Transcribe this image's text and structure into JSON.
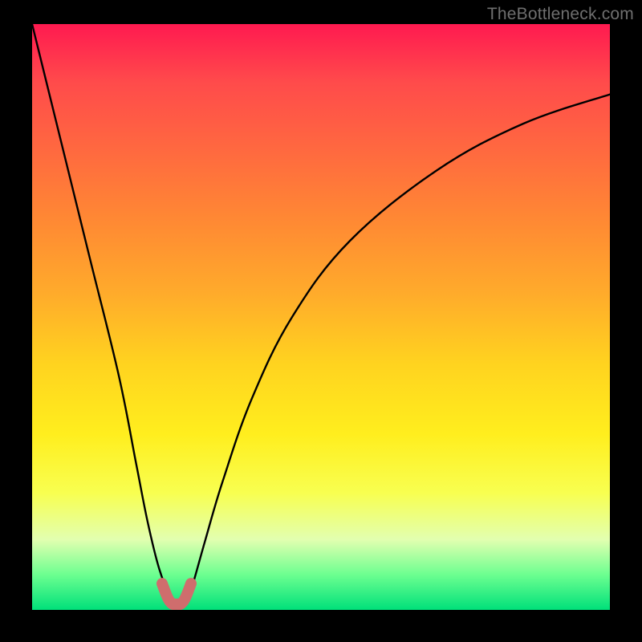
{
  "watermark": {
    "text": "TheBottleneck.com"
  },
  "chart_data": {
    "type": "line",
    "title": "",
    "xlabel": "",
    "ylabel": "",
    "xlim": [
      0,
      100
    ],
    "ylim": [
      0,
      100
    ],
    "grid": false,
    "legend": false,
    "series": [
      {
        "name": "bottleneck-curve",
        "x": [
          0,
          5,
          10,
          15,
          18,
          20,
          22,
          24,
          25,
          26,
          27,
          28,
          30,
          33,
          38,
          45,
          55,
          70,
          85,
          100
        ],
        "values": [
          100,
          80,
          60,
          40,
          25,
          15,
          7,
          2,
          1,
          1,
          2,
          5,
          12,
          22,
          36,
          50,
          63,
          75,
          83,
          88
        ]
      }
    ],
    "highlight": {
      "name": "valley-floor",
      "color": "#cf6d6d",
      "x": [
        22.5,
        23.5,
        24.3,
        25.0,
        25.7,
        26.5,
        27.5
      ],
      "values": [
        4.5,
        2.0,
        1.0,
        1.0,
        1.0,
        2.0,
        4.5
      ]
    },
    "colors": {
      "curve": "#000000",
      "highlight": "#cf6d6d",
      "background_top": "#ff1a50",
      "background_bottom": "#00e07a"
    }
  }
}
